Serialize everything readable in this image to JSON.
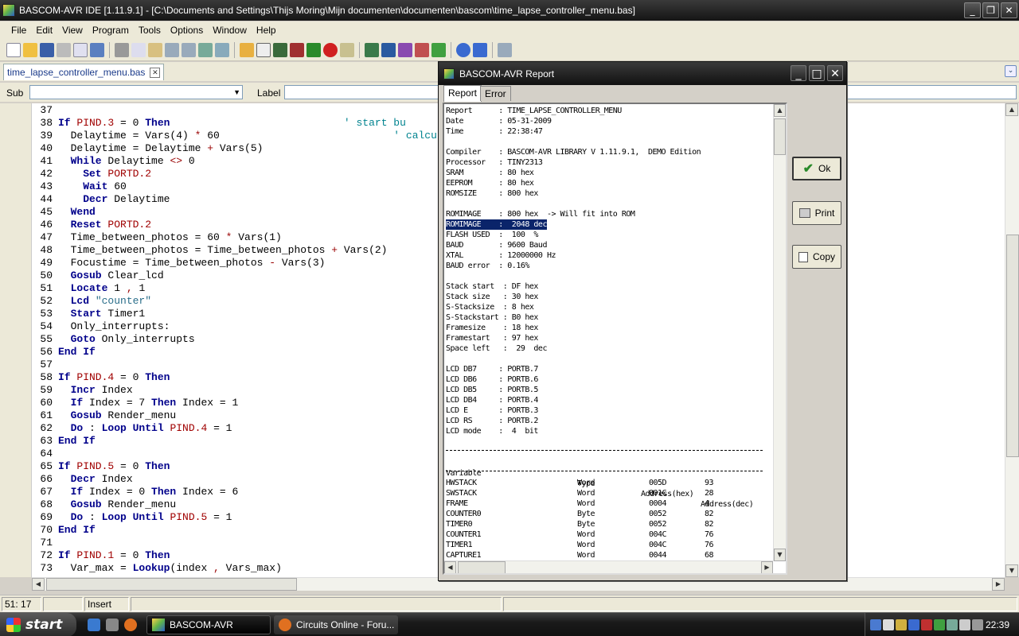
{
  "window": {
    "title": "BASCOM-AVR IDE [1.11.9.1] - [C:\\Documents and Settings\\Thijs Moring\\Mijn documenten\\documenten\\bascom\\time_lapse_controller_menu.bas]",
    "min": "_",
    "max": "❐",
    "close": "✕"
  },
  "menu": [
    "File",
    "Edit",
    "View",
    "Program",
    "Tools",
    "Options",
    "Window",
    "Help"
  ],
  "tab": {
    "label": "time_lapse_controller_menu.bas",
    "close": "✕",
    "dropdown": "⌄"
  },
  "subbar": {
    "sub_label": "Sub",
    "label_label": "Label"
  },
  "code": [
    {
      "n": "37",
      "parts": []
    },
    {
      "n": "38",
      "parts": [
        [
          "kw",
          "If "
        ],
        [
          "pn",
          "PIND.3"
        ],
        [
          "nm",
          " = 0 "
        ],
        [
          "kw",
          "Then"
        ],
        [
          "nm",
          "                            "
        ],
        [
          "cm",
          "' start bu"
        ]
      ]
    },
    {
      "n": "39",
      "parts": [
        [
          "nm",
          "  Delaytime = Vars(4) "
        ],
        [
          "op",
          "*"
        ],
        [
          "nm",
          " 60                            "
        ],
        [
          "cm",
          "' calculat"
        ]
      ]
    },
    {
      "n": "40",
      "parts": [
        [
          "nm",
          "  Delaytime = Delaytime "
        ],
        [
          "op",
          "+"
        ],
        [
          "nm",
          " Vars(5)"
        ]
      ]
    },
    {
      "n": "41",
      "parts": [
        [
          "kw",
          "  While "
        ],
        [
          "nm",
          "Delaytime "
        ],
        [
          "op",
          "<>"
        ],
        [
          "nm",
          " 0"
        ]
      ]
    },
    {
      "n": "42",
      "parts": [
        [
          "kw",
          "    Set "
        ],
        [
          "pn",
          "PORTD.2"
        ]
      ]
    },
    {
      "n": "43",
      "parts": [
        [
          "kw",
          "    Wait "
        ],
        [
          "nm",
          "60"
        ]
      ]
    },
    {
      "n": "44",
      "parts": [
        [
          "kw",
          "    Decr "
        ],
        [
          "nm",
          "Delaytime"
        ]
      ]
    },
    {
      "n": "45",
      "parts": [
        [
          "kw",
          "  Wend"
        ]
      ]
    },
    {
      "n": "46",
      "parts": [
        [
          "kw",
          "  Reset "
        ],
        [
          "pn",
          "PORTD.2"
        ]
      ]
    },
    {
      "n": "47",
      "parts": [
        [
          "nm",
          "  Time_between_photos = 60 "
        ],
        [
          "op",
          "*"
        ],
        [
          "nm",
          " Vars(1)"
        ]
      ]
    },
    {
      "n": "48",
      "parts": [
        [
          "nm",
          "  Time_between_photos = Time_between_photos "
        ],
        [
          "op",
          "+"
        ],
        [
          "nm",
          " Vars(2)"
        ]
      ]
    },
    {
      "n": "49",
      "parts": [
        [
          "nm",
          "  Focustime = Time_between_photos "
        ],
        [
          "op",
          "-"
        ],
        [
          "nm",
          " Vars(3)"
        ]
      ]
    },
    {
      "n": "50",
      "parts": [
        [
          "kw",
          "  Gosub "
        ],
        [
          "nm",
          "Clear_lcd"
        ]
      ]
    },
    {
      "n": "51",
      "parts": [
        [
          "kw",
          "  Locate "
        ],
        [
          "nm",
          "1 "
        ],
        [
          "op",
          ","
        ],
        [
          "nm",
          " 1"
        ]
      ]
    },
    {
      "n": "52",
      "parts": [
        [
          "kw",
          "  Lcd "
        ],
        [
          "st",
          "\"counter\""
        ]
      ]
    },
    {
      "n": "53",
      "parts": [
        [
          "kw",
          "  Start "
        ],
        [
          "nm",
          "Timer1"
        ]
      ]
    },
    {
      "n": "54",
      "parts": [
        [
          "nm",
          "  Only_interrupts:"
        ]
      ]
    },
    {
      "n": "55",
      "parts": [
        [
          "kw",
          "  Goto "
        ],
        [
          "nm",
          "Only_interrupts"
        ]
      ]
    },
    {
      "n": "56",
      "parts": [
        [
          "kw",
          "End If"
        ]
      ]
    },
    {
      "n": "57",
      "parts": []
    },
    {
      "n": "58",
      "parts": [
        [
          "kw",
          "If "
        ],
        [
          "pn",
          "PIND.4"
        ],
        [
          "nm",
          " = 0 "
        ],
        [
          "kw",
          "Then"
        ]
      ]
    },
    {
      "n": "59",
      "parts": [
        [
          "kw",
          "  Incr "
        ],
        [
          "nm",
          "Index"
        ]
      ]
    },
    {
      "n": "60",
      "parts": [
        [
          "kw",
          "  If "
        ],
        [
          "nm",
          "Index = 7 "
        ],
        [
          "kw",
          "Then "
        ],
        [
          "nm",
          "Index = 1"
        ]
      ]
    },
    {
      "n": "61",
      "parts": [
        [
          "kw",
          "  Gosub "
        ],
        [
          "nm",
          "Render_menu"
        ]
      ]
    },
    {
      "n": "62",
      "parts": [
        [
          "kw",
          "  Do "
        ],
        [
          "nm",
          ": "
        ],
        [
          "kw",
          "Loop Until "
        ],
        [
          "pn",
          "PIND.4"
        ],
        [
          "nm",
          " = 1"
        ]
      ]
    },
    {
      "n": "63",
      "parts": [
        [
          "kw",
          "End If"
        ]
      ]
    },
    {
      "n": "64",
      "parts": []
    },
    {
      "n": "65",
      "parts": [
        [
          "kw",
          "If "
        ],
        [
          "pn",
          "PIND.5"
        ],
        [
          "nm",
          " = 0 "
        ],
        [
          "kw",
          "Then"
        ]
      ]
    },
    {
      "n": "66",
      "parts": [
        [
          "kw",
          "  Decr "
        ],
        [
          "nm",
          "Index"
        ]
      ]
    },
    {
      "n": "67",
      "parts": [
        [
          "kw",
          "  If "
        ],
        [
          "nm",
          "Index = 0 "
        ],
        [
          "kw",
          "Then "
        ],
        [
          "nm",
          "Index = 6"
        ]
      ]
    },
    {
      "n": "68",
      "parts": [
        [
          "kw",
          "  Gosub "
        ],
        [
          "nm",
          "Render_menu"
        ]
      ]
    },
    {
      "n": "69",
      "parts": [
        [
          "kw",
          "  Do "
        ],
        [
          "nm",
          ": "
        ],
        [
          "kw",
          "Loop Until "
        ],
        [
          "pn",
          "PIND.5"
        ],
        [
          "nm",
          " = 1"
        ]
      ]
    },
    {
      "n": "70",
      "parts": [
        [
          "kw",
          "End If"
        ]
      ]
    },
    {
      "n": "71",
      "parts": []
    },
    {
      "n": "72",
      "parts": [
        [
          "kw",
          "If "
        ],
        [
          "pn",
          "PIND.1"
        ],
        [
          "nm",
          " = 0 "
        ],
        [
          "kw",
          "Then"
        ]
      ]
    },
    {
      "n": "73",
      "parts": [
        [
          "nm",
          "  Var_max = "
        ],
        [
          "kw",
          "Lookup"
        ],
        [
          "nm",
          "(index "
        ],
        [
          "op",
          ","
        ],
        [
          "nm",
          " Vars_max)"
        ]
      ]
    }
  ],
  "status": {
    "position": "51: 17",
    "mode": "Insert"
  },
  "taskbar": {
    "start": "start",
    "tasks": [
      "BASCOM-AVR",
      "Circuits Online - Foru..."
    ],
    "clock": "22:39"
  },
  "dialog": {
    "title": "BASCOM-AVR Report",
    "tabs": [
      "Report",
      "Error"
    ],
    "buttons": {
      "ok": "Ok",
      "print": "Print",
      "copy": "Copy"
    },
    "report_lines": [
      "Report      : TIME_LAPSE_CONTROLLER_MENU",
      "Date        : 05-31-2009",
      "Time        : 22:38:47",
      "",
      "Compiler    : BASCOM-AVR LIBRARY V 1.11.9.1,  DEMO Edition",
      "Processor   : TINY2313",
      "SRAM        : 80 hex",
      "EEPROM      : 80 hex",
      "ROMSIZE     : 800 hex",
      "",
      "ROMIMAGE    : 800 hex  -> Will fit into ROM",
      "ROMIMAGE    :  2048 dec",
      "FLASH USED  :  100  %",
      "BAUD        : 9600 Baud",
      "XTAL        : 12000000 Hz",
      "BAUD error  : 0.16%",
      "",
      "Stack start  : DF hex",
      "Stack size   : 30 hex",
      "S-Stacksize  : 8 hex",
      "S-Stackstart : B0 hex",
      "Framesize    : 18 hex",
      "Framestart   : 97 hex",
      "Space left   :  29  dec",
      "",
      "LCD DB7     : PORTB.7",
      "LCD DB6     : PORTB.6",
      "LCD DB5     : PORTB.5",
      "LCD DB4     : PORTB.4",
      "LCD E       : PORTB.3",
      "LCD RS      : PORTB.2",
      "LCD mode    :  4  bit"
    ],
    "var_header": [
      "Variable",
      "Type",
      "Address(hex)",
      "Address(dec)"
    ],
    "variables": [
      [
        "HWSTACK",
        "Word",
        "005D",
        "93"
      ],
      [
        "SWSTACK",
        "Word",
        "001C",
        "28"
      ],
      [
        "FRAME",
        "Word",
        "0004",
        "4"
      ],
      [
        "COUNTER0",
        "Byte",
        "0052",
        "82"
      ],
      [
        "TIMER0",
        "Byte",
        "0052",
        "82"
      ],
      [
        "COUNTER1",
        "Word",
        "004C",
        "76"
      ],
      [
        "TIMER1",
        "Word",
        "004C",
        "76"
      ],
      [
        "CAPTURE1",
        "Word",
        "0044",
        "68"
      ]
    ]
  }
}
